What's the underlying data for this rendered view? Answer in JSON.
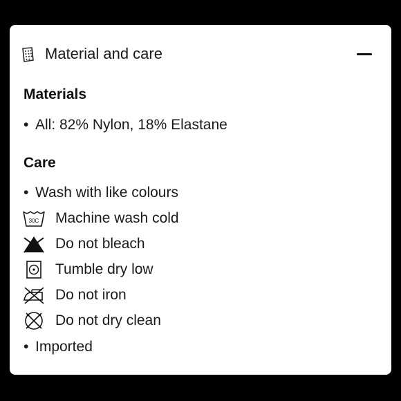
{
  "accordion": {
    "title": "Material and care",
    "header_icon": "fabric-swatch-icon",
    "toggle_icon": "minus-icon"
  },
  "materials": {
    "heading": "Materials",
    "items": [
      "All: 82% Nylon, 18% Elastane"
    ]
  },
  "care": {
    "heading": "Care",
    "bullet_1": "Wash with like colours",
    "instructions": [
      {
        "icon": "machine-wash-30c-icon",
        "icon_text": "30C",
        "label": "Machine wash cold"
      },
      {
        "icon": "do-not-bleach-icon",
        "label": "Do not bleach"
      },
      {
        "icon": "tumble-dry-low-icon",
        "label": "Tumble dry low"
      },
      {
        "icon": "do-not-iron-icon",
        "label": "Do not iron"
      },
      {
        "icon": "do-not-dry-clean-icon",
        "label": "Do not dry clean"
      }
    ],
    "bullet_2": "Imported"
  },
  "bullet_glyph": "•"
}
